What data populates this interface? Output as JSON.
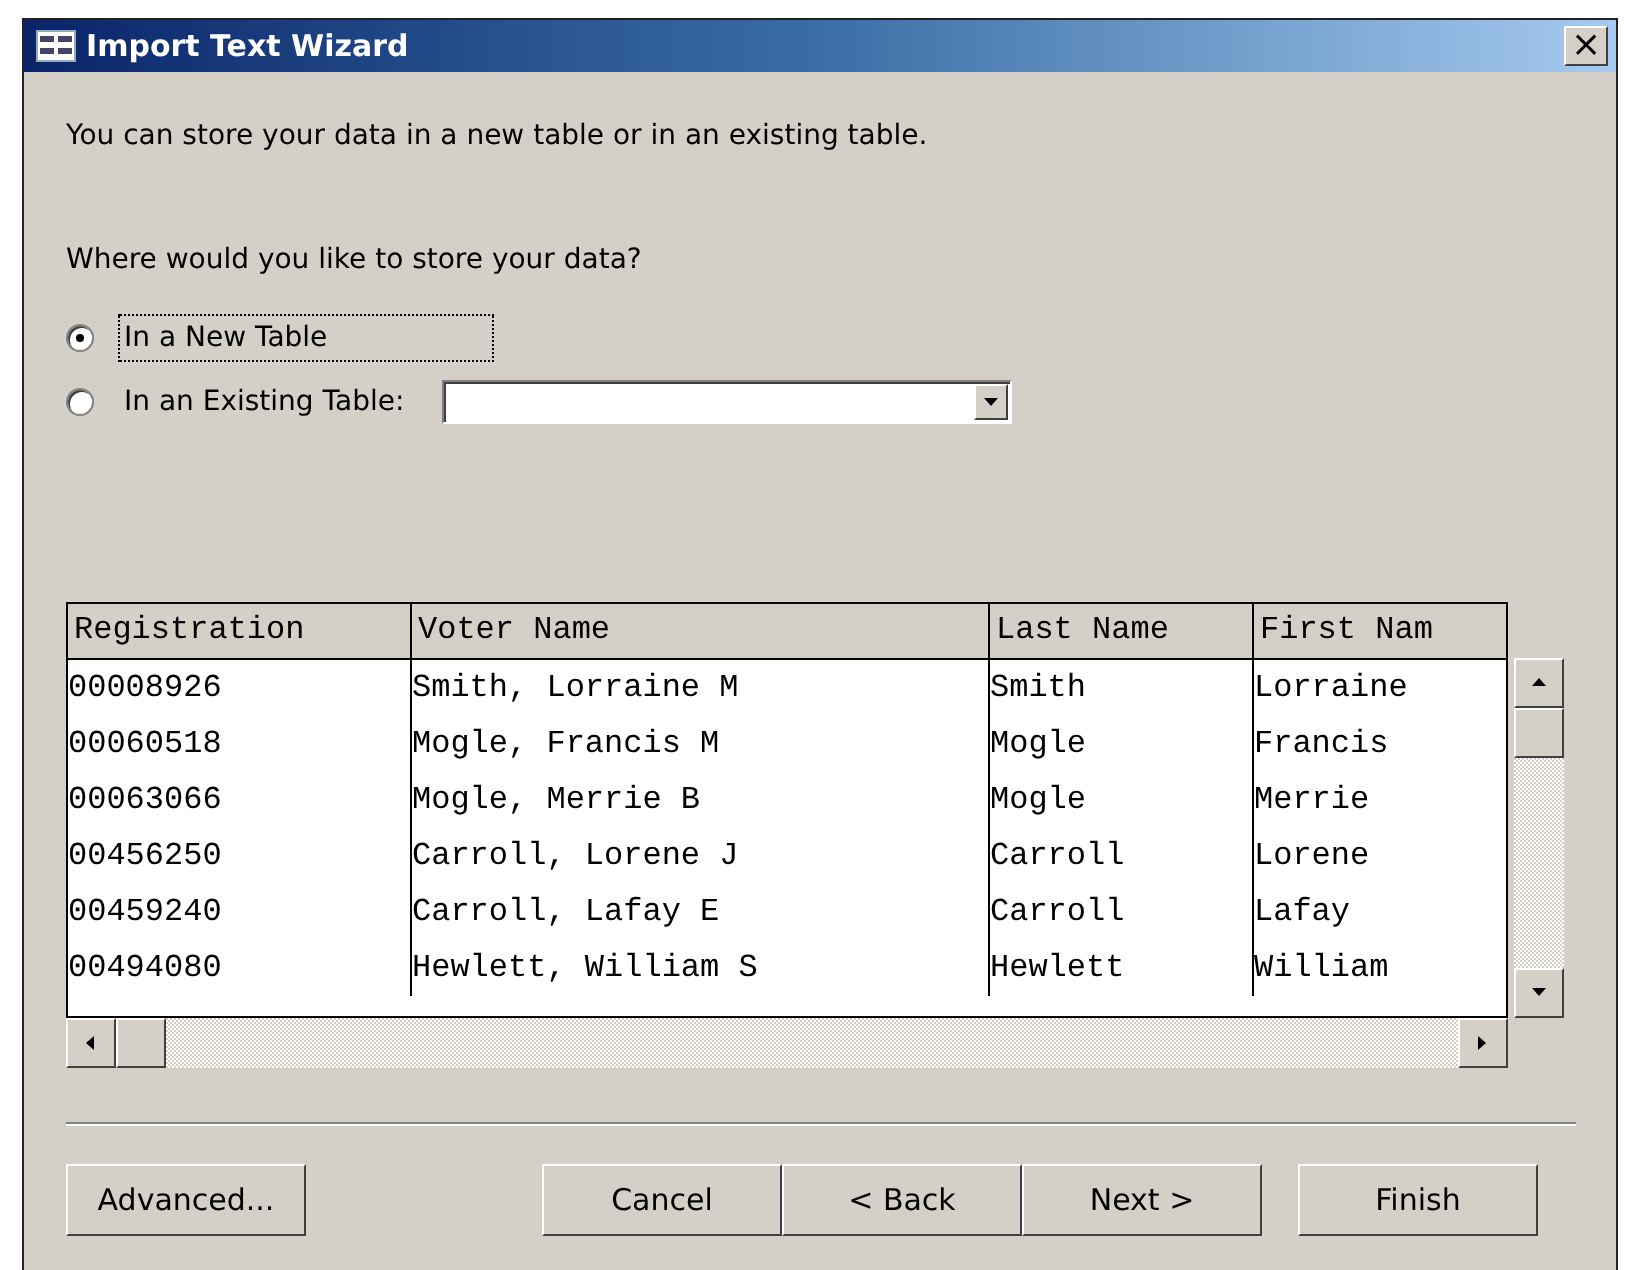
{
  "window": {
    "title": "Import Text Wizard",
    "close": "×"
  },
  "intro": "You can store your data in a new table or in an existing table.",
  "question": "Where would you like to store your data?",
  "options": [
    {
      "label": "In a New Table",
      "selected": true,
      "focused": true
    },
    {
      "label": "In an Existing Table:",
      "selected": false,
      "focused": false
    }
  ],
  "preview": {
    "columns": [
      "Registration",
      "Voter Name",
      "Last Name",
      "First Nam"
    ],
    "rows": [
      [
        "00008926",
        "Smith, Lorraine M",
        "Smith",
        "Lorraine"
      ],
      [
        "00060518",
        "Mogle, Francis M",
        "Mogle",
        "Francis"
      ],
      [
        "00063066",
        "Mogle, Merrie B",
        "Mogle",
        "Merrie"
      ],
      [
        "00456250",
        "Carroll, Lorene J",
        "Carroll",
        "Lorene"
      ],
      [
        "00459240",
        "Carroll, Lafay E",
        "Carroll",
        "Lafay"
      ],
      [
        "00494080",
        "Hewlett, William S",
        "Hewlett",
        "William"
      ]
    ]
  },
  "buttons": [
    {
      "label": "Advanced...",
      "kind": "left"
    },
    {
      "label": "Cancel",
      "kind": "spaced"
    },
    {
      "label": "< Back",
      "kind": "joined"
    },
    {
      "label": "Next >",
      "kind": "joined"
    },
    {
      "label": "Finish",
      "kind": "spaced"
    }
  ]
}
